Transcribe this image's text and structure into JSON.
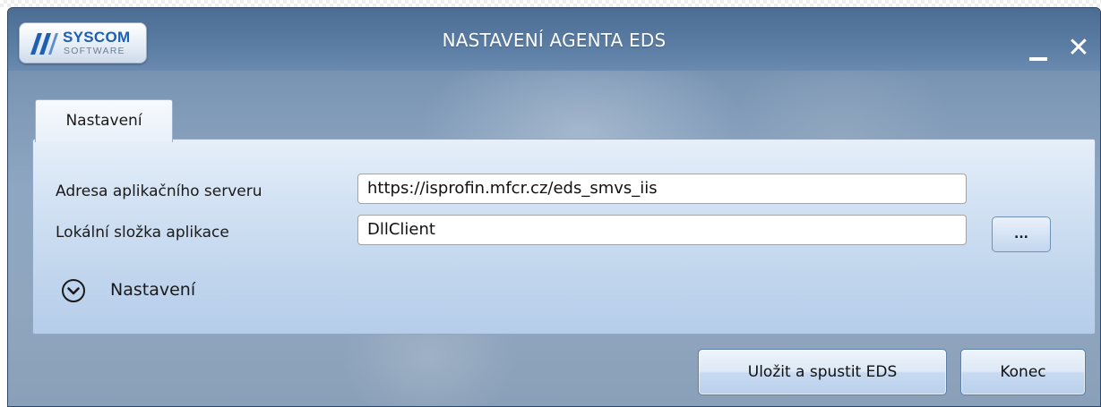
{
  "window": {
    "title": "NASTAVENÍ AGENTA EDS",
    "logo_text": "SYSCOM",
    "logo_subtext": "SOFTWARE",
    "minimize_icon": "minimize-icon",
    "close_label": "✕"
  },
  "tabs": [
    {
      "label": "Nastavení",
      "selected": true
    }
  ],
  "form": {
    "server_label": "Adresa aplikačního serveru",
    "server_value": "https://isprofin.mfcr.cz/eds_smvs_iis",
    "local_label": "Lokální složka aplikace",
    "local_value": "DllClient",
    "browse_label": "...",
    "expander_label": "Nastavení",
    "expander_icon": "chevron-down-circle-icon"
  },
  "actions": {
    "save_label": "Uložit a spustit EDS",
    "end_label": "Konec"
  }
}
